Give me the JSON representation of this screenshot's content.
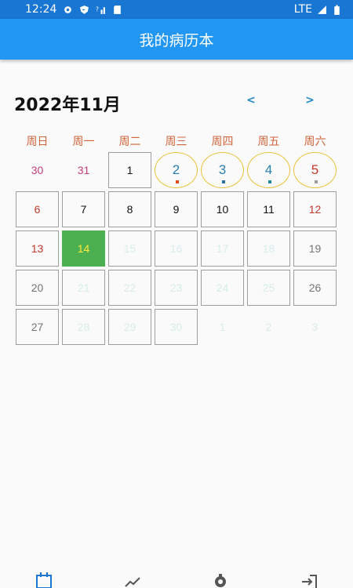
{
  "status_bar": {
    "time": "12:24",
    "network": "LTE"
  },
  "app_bar": {
    "title": "我的病历本"
  },
  "calendar": {
    "month_title": "2022年11月",
    "prev_label": "<",
    "next_label": ">",
    "weekdays": [
      "周日",
      "周一",
      "周二",
      "周三",
      "周四",
      "周五",
      "周六"
    ]
  },
  "days": [
    {
      "label": "30",
      "style": "plain",
      "color": "#c2407a"
    },
    {
      "label": "31",
      "style": "plain",
      "color": "#c2407a"
    },
    {
      "label": "1",
      "style": "box",
      "color": "#111111"
    },
    {
      "label": "2",
      "style": "circle",
      "color": "#2a80b0",
      "dot": "#e64a19"
    },
    {
      "label": "3",
      "style": "circle",
      "color": "#2a80b0",
      "dot": "#2a6fa0"
    },
    {
      "label": "4",
      "style": "circle",
      "color": "#2a80b0",
      "dot": "#1e88a0"
    },
    {
      "label": "5",
      "style": "circle",
      "color": "#c0392b",
      "dot": "#9e9e9e"
    },
    {
      "label": "6",
      "style": "box",
      "color": "#c0392b"
    },
    {
      "label": "7",
      "style": "box",
      "color": "#111111"
    },
    {
      "label": "8",
      "style": "box",
      "color": "#111111"
    },
    {
      "label": "9",
      "style": "box",
      "color": "#111111"
    },
    {
      "label": "10",
      "style": "box",
      "color": "#111111"
    },
    {
      "label": "11",
      "style": "box",
      "color": "#111111"
    },
    {
      "label": "12",
      "style": "box",
      "color": "#c0392b"
    },
    {
      "label": "13",
      "style": "box",
      "color": "#c0392b"
    },
    {
      "label": "14",
      "style": "today",
      "color": "#ffeb3b"
    },
    {
      "label": "15",
      "style": "box",
      "color": "#d7ecea"
    },
    {
      "label": "16",
      "style": "box",
      "color": "#d7ecea"
    },
    {
      "label": "17",
      "style": "box",
      "color": "#d7ecea"
    },
    {
      "label": "18",
      "style": "box",
      "color": "#d7ecea"
    },
    {
      "label": "19",
      "style": "box",
      "color": "#757575"
    },
    {
      "label": "20",
      "style": "box",
      "color": "#757575"
    },
    {
      "label": "21",
      "style": "box",
      "color": "#d7ecea"
    },
    {
      "label": "22",
      "style": "box",
      "color": "#d7ecea"
    },
    {
      "label": "23",
      "style": "box",
      "color": "#d7ecea"
    },
    {
      "label": "24",
      "style": "box",
      "color": "#d7ecea"
    },
    {
      "label": "25",
      "style": "box",
      "color": "#d7ecea"
    },
    {
      "label": "26",
      "style": "box",
      "color": "#757575"
    },
    {
      "label": "27",
      "style": "box",
      "color": "#757575"
    },
    {
      "label": "28",
      "style": "box",
      "color": "#d7ecea"
    },
    {
      "label": "29",
      "style": "box",
      "color": "#d7ecea"
    },
    {
      "label": "30",
      "style": "box",
      "color": "#d7ecea"
    },
    {
      "label": "1",
      "style": "plain",
      "color": "#d7ecea"
    },
    {
      "label": "2",
      "style": "plain",
      "color": "#d7ecea"
    },
    {
      "label": "3",
      "style": "plain",
      "color": "#d7ecea"
    }
  ],
  "bottom_nav": [
    {
      "icon": "calendar-icon",
      "color": "#1976d2"
    },
    {
      "icon": "trend-chart-icon",
      "color": "#555555"
    },
    {
      "icon": "gear-icon",
      "color": "#555555"
    },
    {
      "icon": "logout-icon",
      "color": "#555555"
    }
  ],
  "colors": {
    "primary": "#2196f3",
    "status_bar": "#1976d2",
    "today": "#4caf50",
    "circle_border": "#e8c33b",
    "weekday": "#d0643a"
  }
}
